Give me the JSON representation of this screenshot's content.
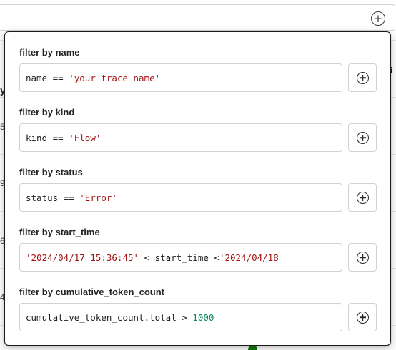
{
  "background": {
    "row_fragments": [
      "y",
      "5",
      "9",
      "6",
      "4"
    ],
    "right_fragment": "i"
  },
  "filters": [
    {
      "label": "filter by name",
      "tokens": [
        {
          "text": "name == ",
          "kind": "plain"
        },
        {
          "text": "'your_trace_name'",
          "kind": "string"
        }
      ]
    },
    {
      "label": "filter by kind",
      "tokens": [
        {
          "text": "kind == ",
          "kind": "plain"
        },
        {
          "text": "'Flow'",
          "kind": "string"
        }
      ]
    },
    {
      "label": "filter by status",
      "tokens": [
        {
          "text": "status == ",
          "kind": "plain"
        },
        {
          "text": "'Error'",
          "kind": "string"
        }
      ]
    },
    {
      "label": "filter by start_time",
      "tokens": [
        {
          "text": "'2024/04/17 15:36:45'",
          "kind": "string"
        },
        {
          "text": " < start_time <",
          "kind": "plain"
        },
        {
          "text": "'2024/04/18",
          "kind": "string"
        }
      ]
    },
    {
      "label": "filter by cumulative_token_count",
      "tokens": [
        {
          "text": "cumulative_token_count.total > ",
          "kind": "plain"
        },
        {
          "text": "1000",
          "kind": "number"
        }
      ]
    }
  ],
  "icons": {
    "add": "add-circle-icon"
  },
  "colors": {
    "string": "#a31515",
    "number": "#098658",
    "status_success": "#107c10"
  }
}
